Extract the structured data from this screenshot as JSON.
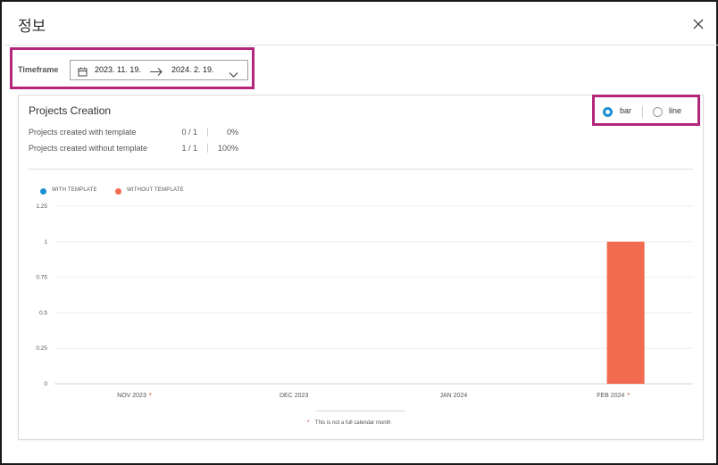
{
  "dialog": {
    "title": "정보",
    "close_icon": "close-icon"
  },
  "timeframe": {
    "label": "Timeframe",
    "start": "2023. 11. 19.",
    "end": "2024. 2. 19.",
    "calendar_icon": "calendar-icon",
    "arrow_icon": "arrow-right-icon",
    "dropdown_icon": "chevron-down-icon"
  },
  "card": {
    "title": "Projects Creation",
    "stats": [
      {
        "label": "Projects created with template",
        "count": "0 / 1",
        "percent": "0%"
      },
      {
        "label": "Projects created without template",
        "count": "1 / 1",
        "percent": "100%"
      }
    ],
    "chart_type_options": [
      {
        "label": "bar",
        "selected": true
      },
      {
        "label": "line",
        "selected": false
      }
    ],
    "footnote": {
      "marker": "*",
      "text": "This is not a full calendar month"
    }
  },
  "colors": {
    "with_template": "#1a8fd0",
    "without_template": "#f26a50",
    "highlight": "#b3267a",
    "partial_marker": "#d0281e"
  },
  "chart_data": {
    "type": "bar",
    "title": "",
    "xlabel": "",
    "ylabel": "",
    "categories": [
      "NOV 2023",
      "DEC 2023",
      "JAN 2024",
      "FEB 2024"
    ],
    "partial_month": [
      true,
      false,
      false,
      true
    ],
    "partial_marker": "*",
    "series": [
      {
        "name": "WITH TEMPLATE",
        "values": [
          0,
          0,
          0,
          0
        ]
      },
      {
        "name": "WITHOUT TEMPLATE",
        "values": [
          0,
          0,
          0,
          1
        ]
      }
    ],
    "ylim": [
      0,
      1.25
    ],
    "yticks": [
      "0",
      "0.25",
      "0.5",
      "0.75",
      "1",
      "1.25"
    ],
    "grid": true,
    "legend": "top-left"
  }
}
